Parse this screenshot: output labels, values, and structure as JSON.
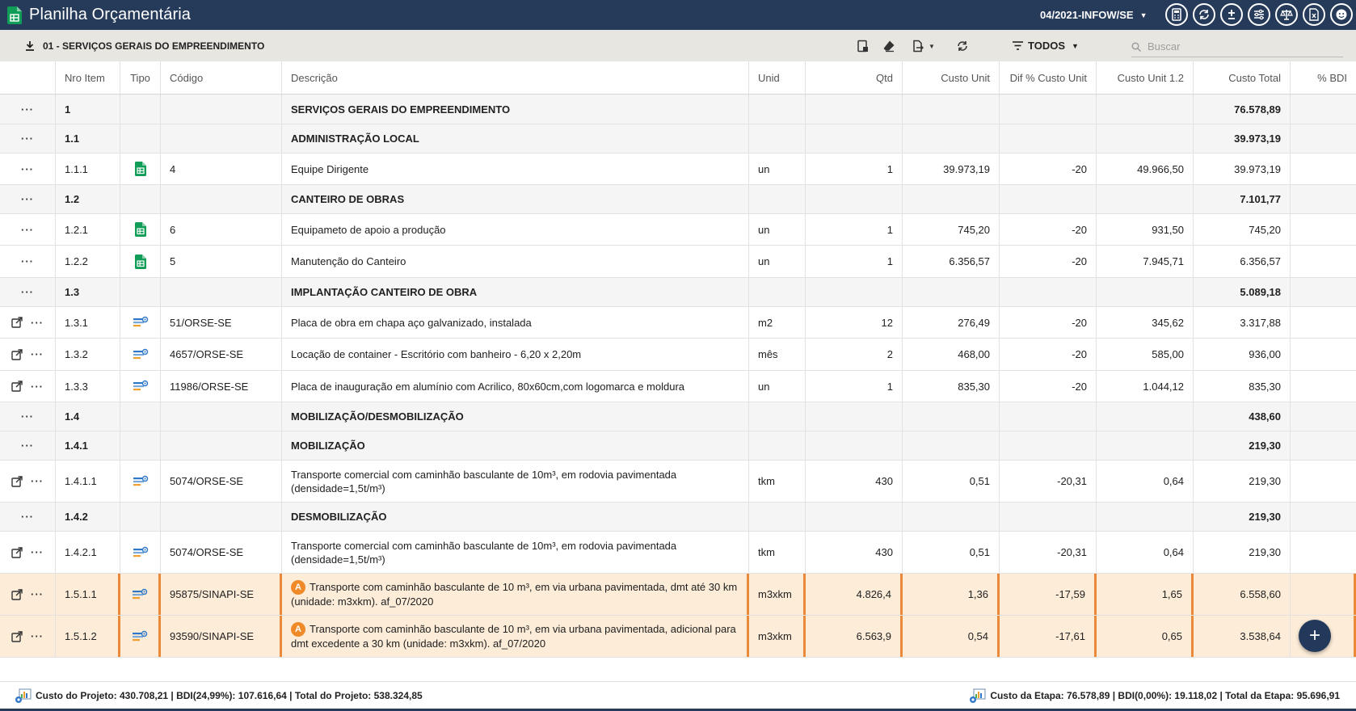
{
  "app": {
    "title": "Planilha Orçamentária",
    "reference": "04/2021-INFOW/SE"
  },
  "toolbar": {
    "section": "01 - SERVIÇOS GERAIS DO EMPREENDIMENTO",
    "filter_label": "TODOS",
    "search_placeholder": "Buscar"
  },
  "columns": [
    "Nro Item",
    "Tipo",
    "Código",
    "Descrição",
    "Unid",
    "Qtd",
    "Custo Unit",
    "Dif % Custo Unit",
    "Custo Unit 1.2",
    "Custo Total",
    "% BDI"
  ],
  "rows": [
    {
      "kind": "group",
      "item": "1",
      "desc": "SERVIÇOS GERAIS DO EMPREENDIMENTO",
      "total": "76.578,89"
    },
    {
      "kind": "group",
      "item": "1.1",
      "desc": "ADMINISTRAÇÃO LOCAL",
      "total": "39.973,19"
    },
    {
      "kind": "item",
      "tipo": "composition",
      "item": "1.1.1",
      "code": "4",
      "desc": "Equipe Dirigente",
      "unit": "un",
      "qty": "1",
      "cu": "39.973,19",
      "dif": "-20",
      "cu12": "49.966,50",
      "total": "39.973,19"
    },
    {
      "kind": "group",
      "item": "1.2",
      "desc": "CANTEIRO DE OBRAS",
      "total": "7.101,77"
    },
    {
      "kind": "item",
      "tipo": "composition",
      "item": "1.2.1",
      "code": "6",
      "desc": "Equipameto de apoio a produção",
      "unit": "un",
      "qty": "1",
      "cu": "745,20",
      "dif": "-20",
      "cu12": "931,50",
      "total": "745,20"
    },
    {
      "kind": "item",
      "tipo": "composition",
      "item": "1.2.2",
      "code": "5",
      "desc": "Manutenção do Canteiro",
      "unit": "un",
      "qty": "1",
      "cu": "6.356,57",
      "dif": "-20",
      "cu12": "7.945,71",
      "total": "6.356,57"
    },
    {
      "kind": "group",
      "item": "1.3",
      "desc": "IMPLANTAÇÃO CANTEIRO DE OBRA",
      "total": "5.089,18"
    },
    {
      "kind": "item",
      "tipo": "base",
      "link": true,
      "item": "1.3.1",
      "code": "51/ORSE-SE",
      "desc": "Placa de obra em chapa aço galvanizado, instalada",
      "unit": "m2",
      "qty": "12",
      "cu": "276,49",
      "dif": "-20",
      "cu12": "345,62",
      "total": "3.317,88"
    },
    {
      "kind": "item",
      "tipo": "base",
      "link": true,
      "item": "1.3.2",
      "code": "4657/ORSE-SE",
      "desc": "Locação de container - Escritório com banheiro - 6,20 x 2,20m",
      "unit": "mês",
      "qty": "2",
      "cu": "468,00",
      "dif": "-20",
      "cu12": "585,00",
      "total": "936,00"
    },
    {
      "kind": "item",
      "tipo": "base",
      "link": true,
      "item": "1.3.3",
      "code": "11986/ORSE-SE",
      "desc": "Placa de inauguração em alumínio com Acrilico, 80x60cm,com logomarca e moldura",
      "unit": "un",
      "qty": "1",
      "cu": "835,30",
      "dif": "-20",
      "cu12": "1.044,12",
      "total": "835,30"
    },
    {
      "kind": "group",
      "item": "1.4",
      "desc": "MOBILIZAÇÃO/DESMOBILIZAÇÃO",
      "total": "438,60"
    },
    {
      "kind": "group",
      "item": "1.4.1",
      "desc": "MOBILIZAÇÃO",
      "total": "219,30"
    },
    {
      "kind": "item",
      "tipo": "base",
      "link": true,
      "item": "1.4.1.1",
      "code": "5074/ORSE-SE",
      "desc": "Transporte comercial com caminhão basculante de 10m³, em rodovia pavimentada (densidade=1,5t/m³)",
      "unit": "tkm",
      "qty": "430",
      "cu": "0,51",
      "dif": "-20,31",
      "cu12": "0,64",
      "total": "219,30"
    },
    {
      "kind": "group",
      "item": "1.4.2",
      "desc": "DESMOBILIZAÇÃO",
      "total": "219,30"
    },
    {
      "kind": "item",
      "tipo": "base",
      "link": true,
      "item": "1.4.2.1",
      "code": "5074/ORSE-SE",
      "desc": "Transporte comercial com caminhão basculante de 10m³, em rodovia pavimentada (densidade=1,5t/m³)",
      "unit": "tkm",
      "qty": "430",
      "cu": "0,51",
      "dif": "-20,31",
      "cu12": "0,64",
      "total": "219,30"
    },
    {
      "kind": "highlight",
      "tipo": "base",
      "link": true,
      "badge": "A",
      "item": "1.5.1.1",
      "code": "95875/SINAPI-SE",
      "desc": "Transporte com caminhão basculante de 10 m³, em via urbana pavimentada, dmt até 30 km (unidade: m3xkm). af_07/2020",
      "unit": "m3xkm",
      "qty": "4.826,4",
      "cu": "1,36",
      "dif": "-17,59",
      "cu12": "1,65",
      "total": "6.558,60"
    },
    {
      "kind": "highlight",
      "tipo": "base",
      "link": true,
      "badge": "A",
      "item": "1.5.1.2",
      "code": "93590/SINAPI-SE",
      "desc": "Transporte com caminhão basculante de 10 m³, em via urbana pavimentada, adicional para dmt excedente a 30 km (unidade: m3xkm). af_07/2020",
      "unit": "m3xkm",
      "qty": "6.563,9",
      "cu": "0,54",
      "dif": "-17,61",
      "cu12": "0,65",
      "total": "3.538,64"
    }
  ],
  "footer": {
    "project": "Custo do Projeto: 430.708,21 | BDI(24,99%): 107.616,64 | Total do Projeto: 538.324,85",
    "stage": "Custo da Etapa: 76.578,89 | BDI(0,00%): 19.118,02 | Total da Etapa: 95.696,91"
  },
  "colors": {
    "header_bg": "#263a5a",
    "toolbar_bg": "#e8e6e1",
    "highlight_bg": "#fcecd8",
    "highlight_border": "#e88a3a",
    "badge": "#f08a28"
  }
}
